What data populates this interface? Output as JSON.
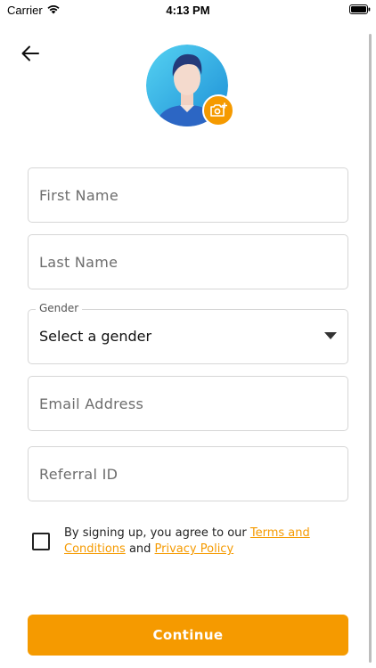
{
  "status_bar": {
    "carrier": "Carrier",
    "time": "4:13 PM"
  },
  "icons": {
    "back": "arrow-left-icon",
    "camera": "camera-add-icon",
    "avatar": "user-avatar-icon",
    "caret": "caret-down-icon"
  },
  "form": {
    "first_name": {
      "value": "",
      "placeholder": "First Name"
    },
    "last_name": {
      "value": "",
      "placeholder": "Last Name"
    },
    "gender": {
      "legend": "Gender",
      "selected": "Select a gender"
    },
    "email": {
      "value": "",
      "placeholder": "Email Address"
    },
    "referral": {
      "value": "",
      "placeholder": "Referral ID"
    }
  },
  "terms": {
    "prefix": "By signing up, you agree to our ",
    "terms_link": "Terms and Conditions",
    "middle": " and ",
    "privacy_link": "Privacy Policy",
    "checked": false
  },
  "continue_label": "Continue",
  "colors": {
    "accent": "#f59a00",
    "border": "#d6d6d6",
    "avatar_bg": "#2bb6e6"
  }
}
